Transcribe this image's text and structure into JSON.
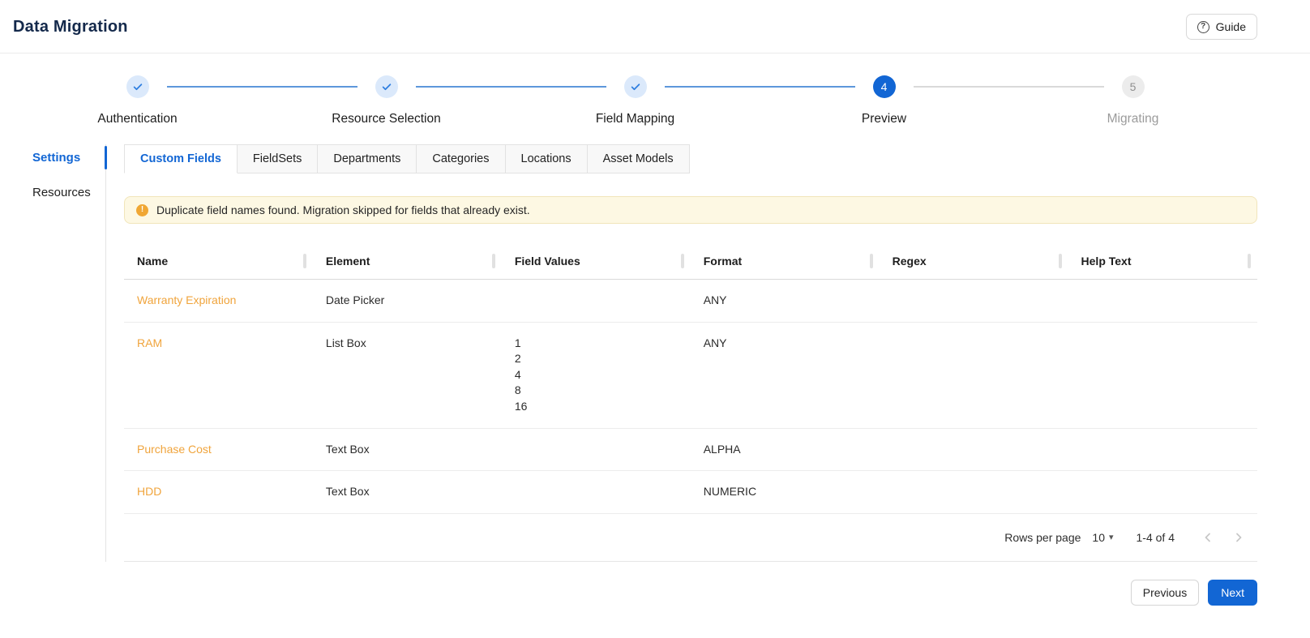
{
  "colors": {
    "accent": "#1266d4",
    "title_navy": "#14294b",
    "name_link_orange": "#f0a43c",
    "alert_bg": "#fdf8e3",
    "alert_border": "#f1e5ba",
    "alert_icon_orange": "#f0a734",
    "step_complete_bg": "#dbe9fb",
    "step_pending_bg": "#ececec"
  },
  "header": {
    "title": "Data Migration",
    "guide_label": "Guide"
  },
  "stepper": {
    "steps": [
      {
        "label": "Authentication",
        "state": "complete"
      },
      {
        "label": "Resource Selection",
        "state": "complete"
      },
      {
        "label": "Field Mapping",
        "state": "complete"
      },
      {
        "label": "Preview",
        "state": "active",
        "number": "4"
      },
      {
        "label": "Migrating",
        "state": "pending",
        "number": "5"
      }
    ]
  },
  "sidebar": {
    "items": [
      {
        "label": "Settings",
        "active": true
      },
      {
        "label": "Resources",
        "active": false
      }
    ]
  },
  "tabs": [
    {
      "label": "Custom Fields",
      "active": true
    },
    {
      "label": "FieldSets",
      "active": false
    },
    {
      "label": "Departments",
      "active": false
    },
    {
      "label": "Categories",
      "active": false
    },
    {
      "label": "Locations",
      "active": false
    },
    {
      "label": "Asset Models",
      "active": false
    }
  ],
  "alert": {
    "message": "Duplicate field names found. Migration skipped for fields that already exist."
  },
  "table": {
    "columns": [
      "Name",
      "Element",
      "Field Values",
      "Format",
      "Regex",
      "Help Text"
    ],
    "rows": [
      {
        "name": "Warranty Expiration",
        "element": "Date Picker",
        "field_values": [],
        "format": "ANY",
        "regex": "",
        "help_text": ""
      },
      {
        "name": "RAM",
        "element": "List Box",
        "field_values": [
          "1",
          "2",
          "4",
          "8",
          "16"
        ],
        "format": "ANY",
        "regex": "",
        "help_text": ""
      },
      {
        "name": "Purchase Cost",
        "element": "Text Box",
        "field_values": [],
        "format": "ALPHA",
        "regex": "",
        "help_text": ""
      },
      {
        "name": "HDD",
        "element": "Text Box",
        "field_values": [],
        "format": "NUMERIC",
        "regex": "",
        "help_text": ""
      }
    ]
  },
  "pagination": {
    "rows_per_page_label": "Rows per page",
    "rows_per_page_value": "10",
    "range_label": "1-4 of 4"
  },
  "actions": {
    "previous_label": "Previous",
    "next_label": "Next"
  }
}
